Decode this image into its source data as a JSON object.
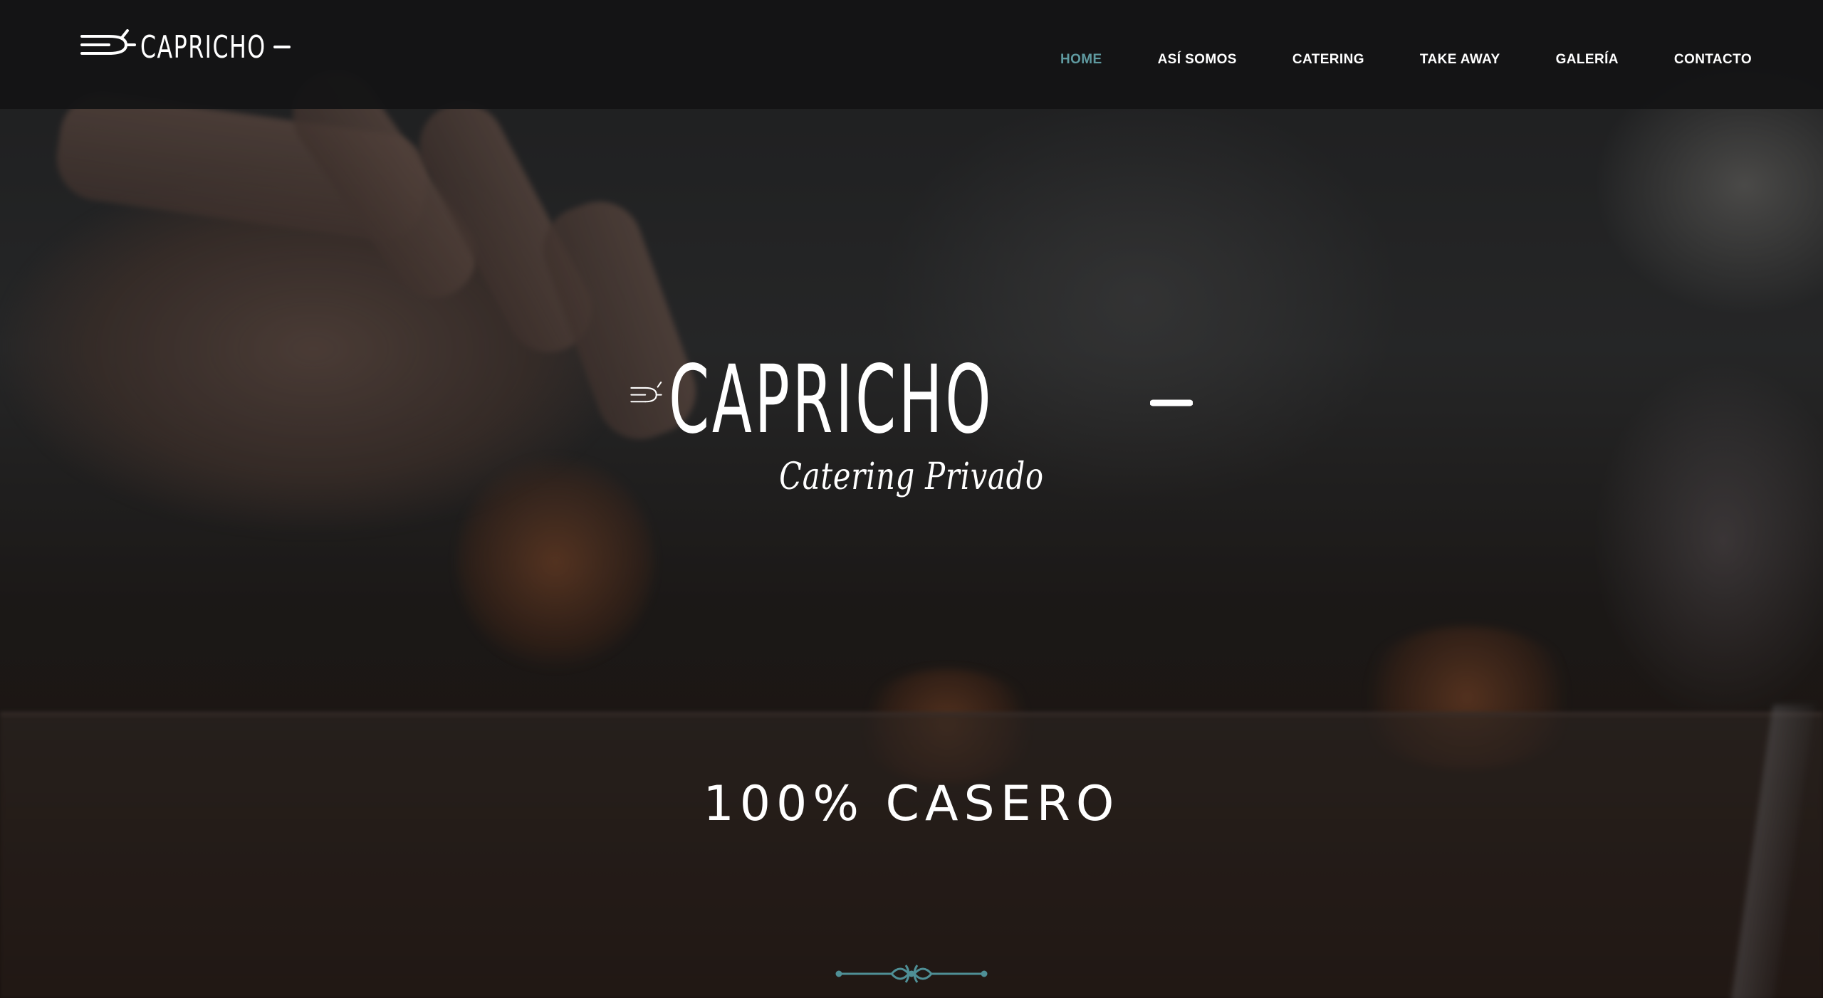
{
  "brand": {
    "name": "CAPRICHO",
    "tagline": "Catering Privado"
  },
  "nav": {
    "items": [
      {
        "label": "HOME",
        "active": true
      },
      {
        "label": "ASÍ SOMOS",
        "active": false
      },
      {
        "label": "CATERING",
        "active": false
      },
      {
        "label": "TAKE AWAY",
        "active": false
      },
      {
        "label": "GALERÍA",
        "active": false
      },
      {
        "label": "CONTACTO",
        "active": false
      }
    ]
  },
  "hero": {
    "headline": "100% CASERO",
    "background": "cooking-video-frame",
    "scroll_ornament_icon": "ornament-divider-icon"
  },
  "colors": {
    "accent": "#5f9aa0",
    "header_bg": "#141415",
    "text": "#ffffff"
  }
}
